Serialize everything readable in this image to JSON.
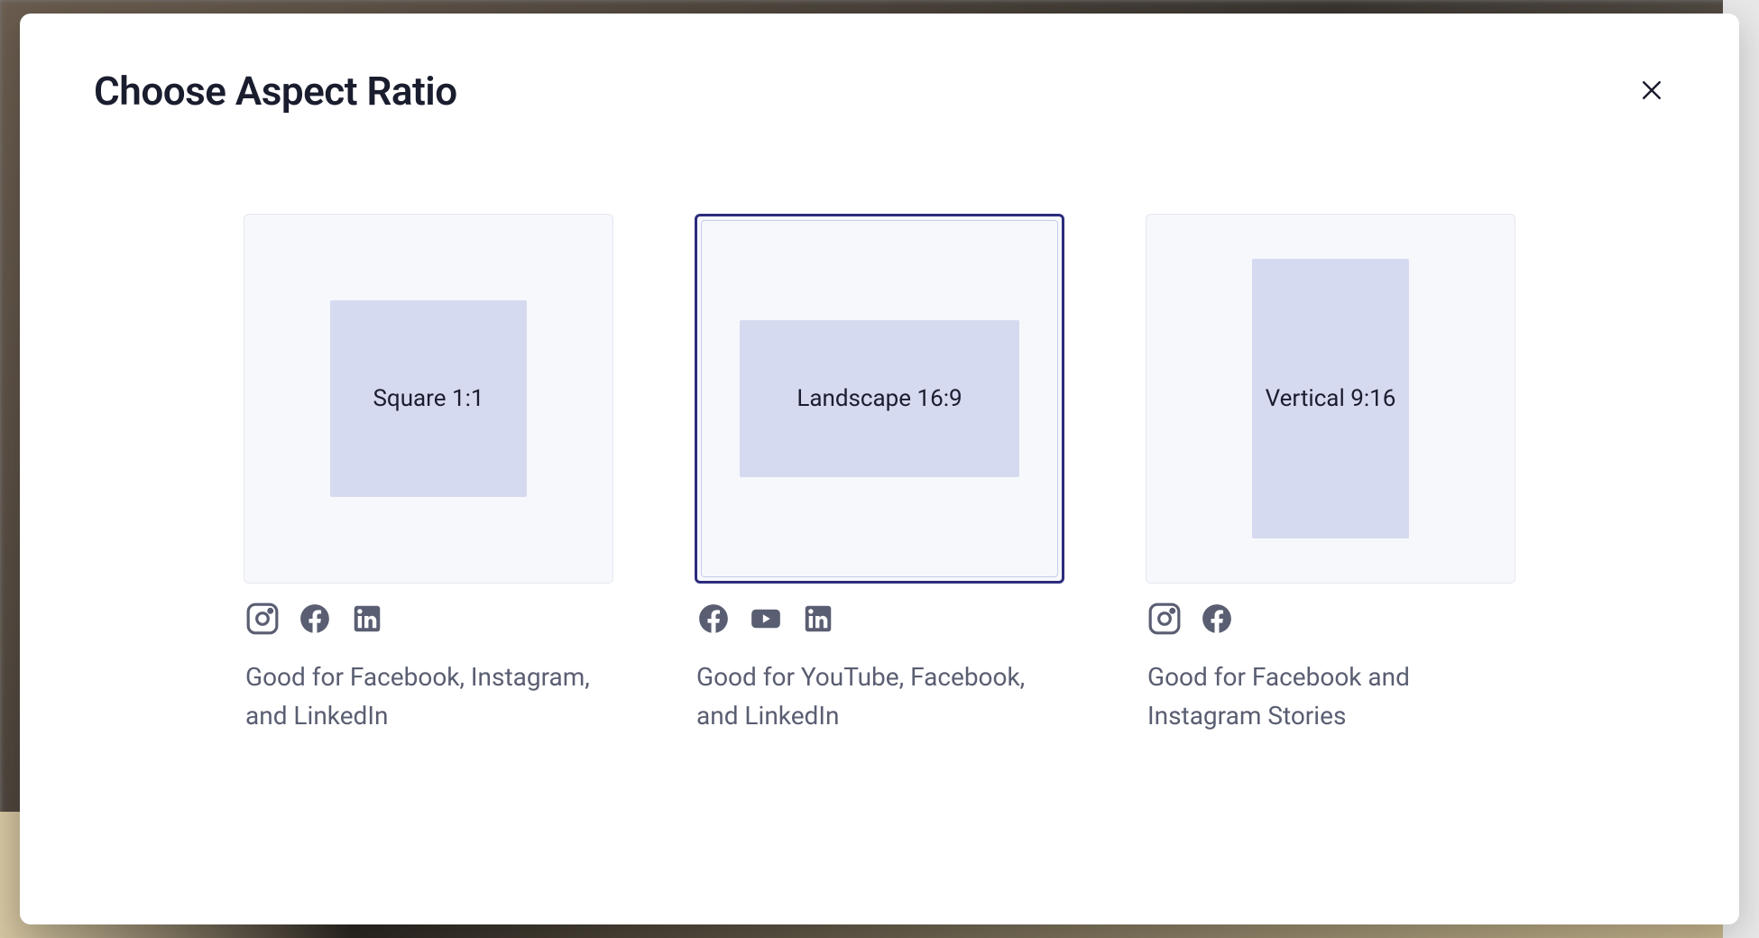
{
  "modal": {
    "title": "Choose Aspect Ratio"
  },
  "options": [
    {
      "label": "Square 1:1",
      "description": "Good for Facebook, Instagram, and LinkedIn",
      "selected": false,
      "icons": [
        "instagram",
        "facebook",
        "linkedin"
      ]
    },
    {
      "label": "Landscape 16:9",
      "description": "Good for YouTube, Facebook, and LinkedIn",
      "selected": true,
      "icons": [
        "facebook",
        "youtube",
        "linkedin"
      ]
    },
    {
      "label": "Vertical 9:16",
      "description": "Good for Facebook and Instagram Stories",
      "selected": false,
      "icons": [
        "instagram",
        "facebook"
      ]
    }
  ]
}
